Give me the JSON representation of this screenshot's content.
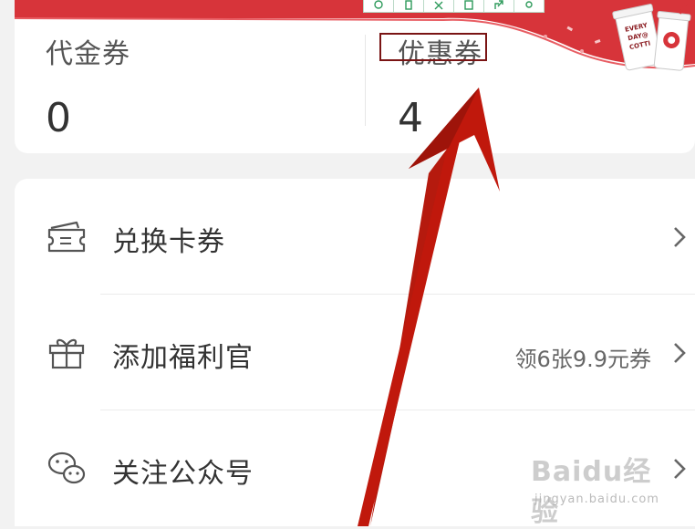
{
  "coupon_stats": {
    "voucher": {
      "label": "代金券",
      "value": "0"
    },
    "discount": {
      "label": "优惠券",
      "value": "4"
    }
  },
  "toolbar": {
    "icons": [
      "zoom-icon",
      "copy-icon",
      "expand-icon",
      "save-icon",
      "share-icon",
      "settings-icon"
    ]
  },
  "badge": {
    "text": "EVERY DAY@ COTTI"
  },
  "menu": {
    "items": [
      {
        "label": "兑换卡券",
        "extra": "",
        "icon": "coupon-ticket-icon"
      },
      {
        "label": "添加福利官",
        "extra": "领6张9.9元券",
        "icon": "gift-icon"
      },
      {
        "label": "关注公众号",
        "extra": "",
        "icon": "wechat-icon"
      }
    ]
  },
  "watermark": {
    "title": "Baidu经验",
    "url": "jingyan.baidu.com"
  },
  "colors": {
    "brand_red": "#d7343a",
    "arrow_red": "#c0180c",
    "highlight_border": "#7a1414"
  }
}
